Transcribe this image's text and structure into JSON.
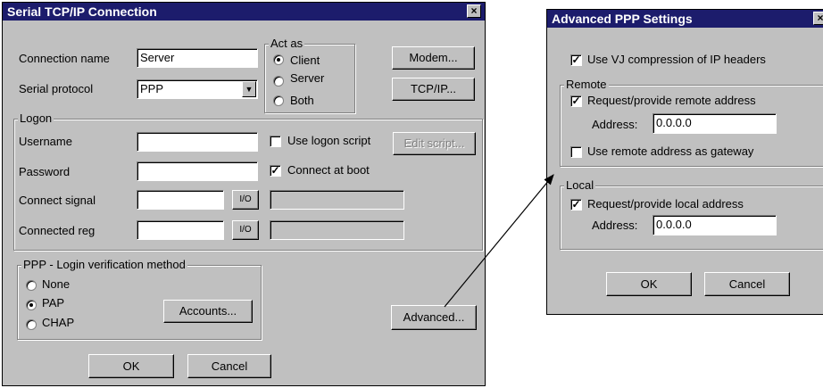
{
  "serial": {
    "title": "Serial TCP/IP Connection",
    "close_glyph": "×",
    "connection_name_label": "Connection name",
    "connection_name_value": "Server",
    "serial_protocol_label": "Serial protocol",
    "serial_protocol_value": "PPP",
    "act_as": {
      "label": "Act as",
      "options": [
        "Client",
        "Server",
        "Both"
      ],
      "selected": "Client"
    },
    "modem_button": "Modem...",
    "tcpip_button": "TCP/IP...",
    "logon": {
      "label": "Logon",
      "username_label": "Username",
      "username_value": "",
      "password_label": "Password",
      "password_value": "",
      "connect_signal_label": "Connect signal",
      "connected_reg_label": "Connected reg",
      "io_button": "I/O",
      "use_logon_script_label": "Use logon script",
      "use_logon_script_checked": false,
      "connect_at_boot_label": "Connect at boot",
      "connect_at_boot_checked": true,
      "edit_script_button": "Edit script..."
    },
    "ppp": {
      "label": "PPP - Login verification method",
      "options": [
        "None",
        "PAP",
        "CHAP"
      ],
      "selected": "PAP",
      "accounts_button": "Accounts..."
    },
    "advanced_button": "Advanced...",
    "ok_button": "OK",
    "cancel_button": "Cancel"
  },
  "advanced": {
    "title": "Advanced PPP Settings",
    "close_glyph": "×",
    "vj_label": "Use VJ compression of IP headers",
    "vj_checked": true,
    "remote": {
      "label": "Remote",
      "request_label": "Request/provide remote address",
      "request_checked": true,
      "address_label": "Address:",
      "address_value": "0.0.0.0",
      "gateway_label": "Use remote address as gateway",
      "gateway_checked": false
    },
    "local": {
      "label": "Local",
      "request_label": "Request/provide local address",
      "request_checked": true,
      "address_label": "Address:",
      "address_value": "0.0.0.0"
    },
    "ok_button": "OK",
    "cancel_button": "Cancel"
  },
  "check_glyph": "✓",
  "dropdown_glyph": "▼"
}
